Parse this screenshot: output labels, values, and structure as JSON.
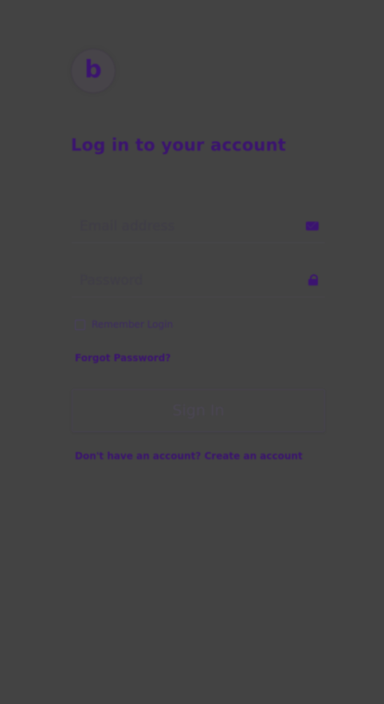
{
  "logo": {
    "letter": "b"
  },
  "title": "Log in to your account",
  "form": {
    "email_placeholder": "Email address",
    "password_placeholder": "Password",
    "remember_label": "Remember Login",
    "forgot_label": "Forgot Password?",
    "signin_label": "Sign In",
    "signup_label": "Don't have an account? Create an account"
  },
  "colors": {
    "background": "#434343",
    "accent": "#3b1370"
  }
}
